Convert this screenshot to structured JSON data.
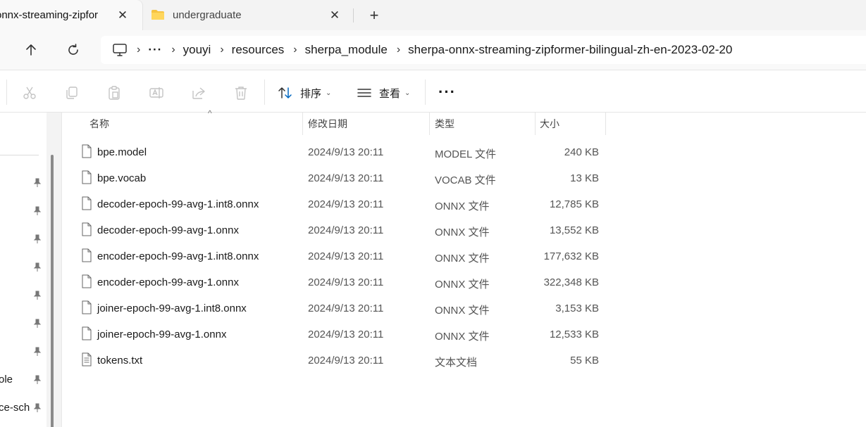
{
  "tabs": [
    {
      "label": "onnx-streaming-zipfor",
      "close_glyph": "✕"
    },
    {
      "label": "undergraduate",
      "close_glyph": "✕"
    }
  ],
  "new_tab_glyph": "+",
  "breadcrumb": {
    "ellipsis": "···",
    "separator": "›",
    "items": [
      "youyi",
      "resources",
      "sherpa_module",
      "sherpa-onnx-streaming-zipformer-bilingual-zh-en-2023-02-20"
    ]
  },
  "commandbar": {
    "sort_label": "排序",
    "view_label": "查看",
    "caret": "⌄",
    "more": "···"
  },
  "sidebar": {
    "partial_items": [
      "ole",
      "ce-sch"
    ]
  },
  "columns": {
    "name": "名称",
    "date": "修改日期",
    "type": "类型",
    "size": "大小",
    "sort_glyph": "^"
  },
  "files": [
    {
      "name": "bpe.model",
      "date": "2024/9/13 20:11",
      "type": "MODEL 文件",
      "size": "240 KB",
      "icon": "file-icon"
    },
    {
      "name": "bpe.vocab",
      "date": "2024/9/13 20:11",
      "type": "VOCAB 文件",
      "size": "13 KB",
      "icon": "file-icon"
    },
    {
      "name": "decoder-epoch-99-avg-1.int8.onnx",
      "date": "2024/9/13 20:11",
      "type": "ONNX 文件",
      "size": "12,785 KB",
      "icon": "file-icon"
    },
    {
      "name": "decoder-epoch-99-avg-1.onnx",
      "date": "2024/9/13 20:11",
      "type": "ONNX 文件",
      "size": "13,552 KB",
      "icon": "file-icon"
    },
    {
      "name": "encoder-epoch-99-avg-1.int8.onnx",
      "date": "2024/9/13 20:11",
      "type": "ONNX 文件",
      "size": "177,632 KB",
      "icon": "file-icon"
    },
    {
      "name": "encoder-epoch-99-avg-1.onnx",
      "date": "2024/9/13 20:11",
      "type": "ONNX 文件",
      "size": "322,348 KB",
      "icon": "file-icon"
    },
    {
      "name": "joiner-epoch-99-avg-1.int8.onnx",
      "date": "2024/9/13 20:11",
      "type": "ONNX 文件",
      "size": "3,153 KB",
      "icon": "file-icon"
    },
    {
      "name": "joiner-epoch-99-avg-1.onnx",
      "date": "2024/9/13 20:11",
      "type": "ONNX 文件",
      "size": "12,533 KB",
      "icon": "file-icon"
    },
    {
      "name": "tokens.txt",
      "date": "2024/9/13 20:11",
      "type": "文本文档",
      "size": "55 KB",
      "icon": "text-file-icon"
    }
  ],
  "colors": {
    "folder": "#f6c342",
    "accent": "#0067c0",
    "icon_gray": "#c4c4c4"
  }
}
